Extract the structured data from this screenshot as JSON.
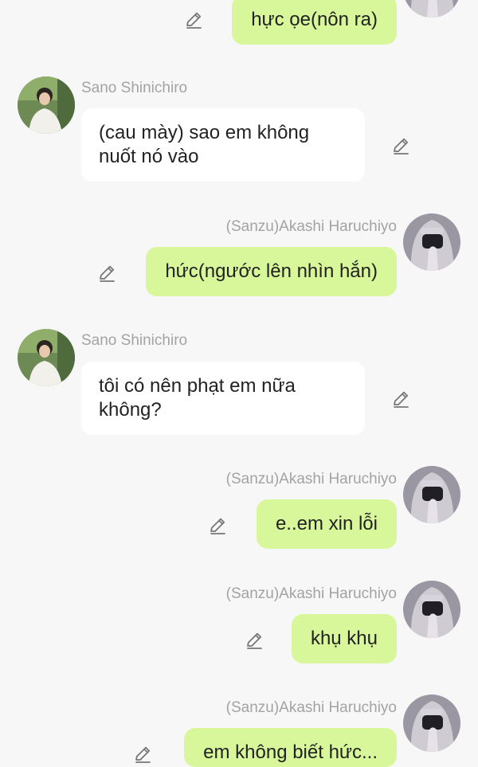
{
  "messages": [
    {
      "side": "right",
      "text": "hực ọe(nôn ra)"
    },
    {
      "side": "left",
      "sender": "Sano Shinichiro",
      "text": "(cau mày) sao em không nuốt nó vào"
    },
    {
      "side": "right",
      "sender": "(Sanzu)Akashi Haruchiyo",
      "text": "hức(ngước lên nhìn hắn)"
    },
    {
      "side": "left",
      "sender": "Sano Shinichiro",
      "text": "tôi có nên phạt em nữa không?"
    },
    {
      "side": "right",
      "sender": "(Sanzu)Akashi Haruchiyo",
      "text": "e..em xin lỗi"
    },
    {
      "side": "right",
      "sender": "(Sanzu)Akashi Haruchiyo",
      "text": "khụ khụ"
    },
    {
      "side": "right",
      "sender": "(Sanzu)Akashi Haruchiyo",
      "text": "em không biết hức..."
    }
  ],
  "icons": {
    "edit": "pencil-edit-icon",
    "avatar_left": "avatar-sano-shinichiro",
    "avatar_right": "avatar-sanzu-akashi-haruchiyo"
  },
  "colors": {
    "background": "#f7f7f7",
    "incoming_bubble": "#ffffff",
    "outgoing_bubble": "#d8f79a",
    "sender_name": "#a3a3a3",
    "text": "#222222"
  }
}
